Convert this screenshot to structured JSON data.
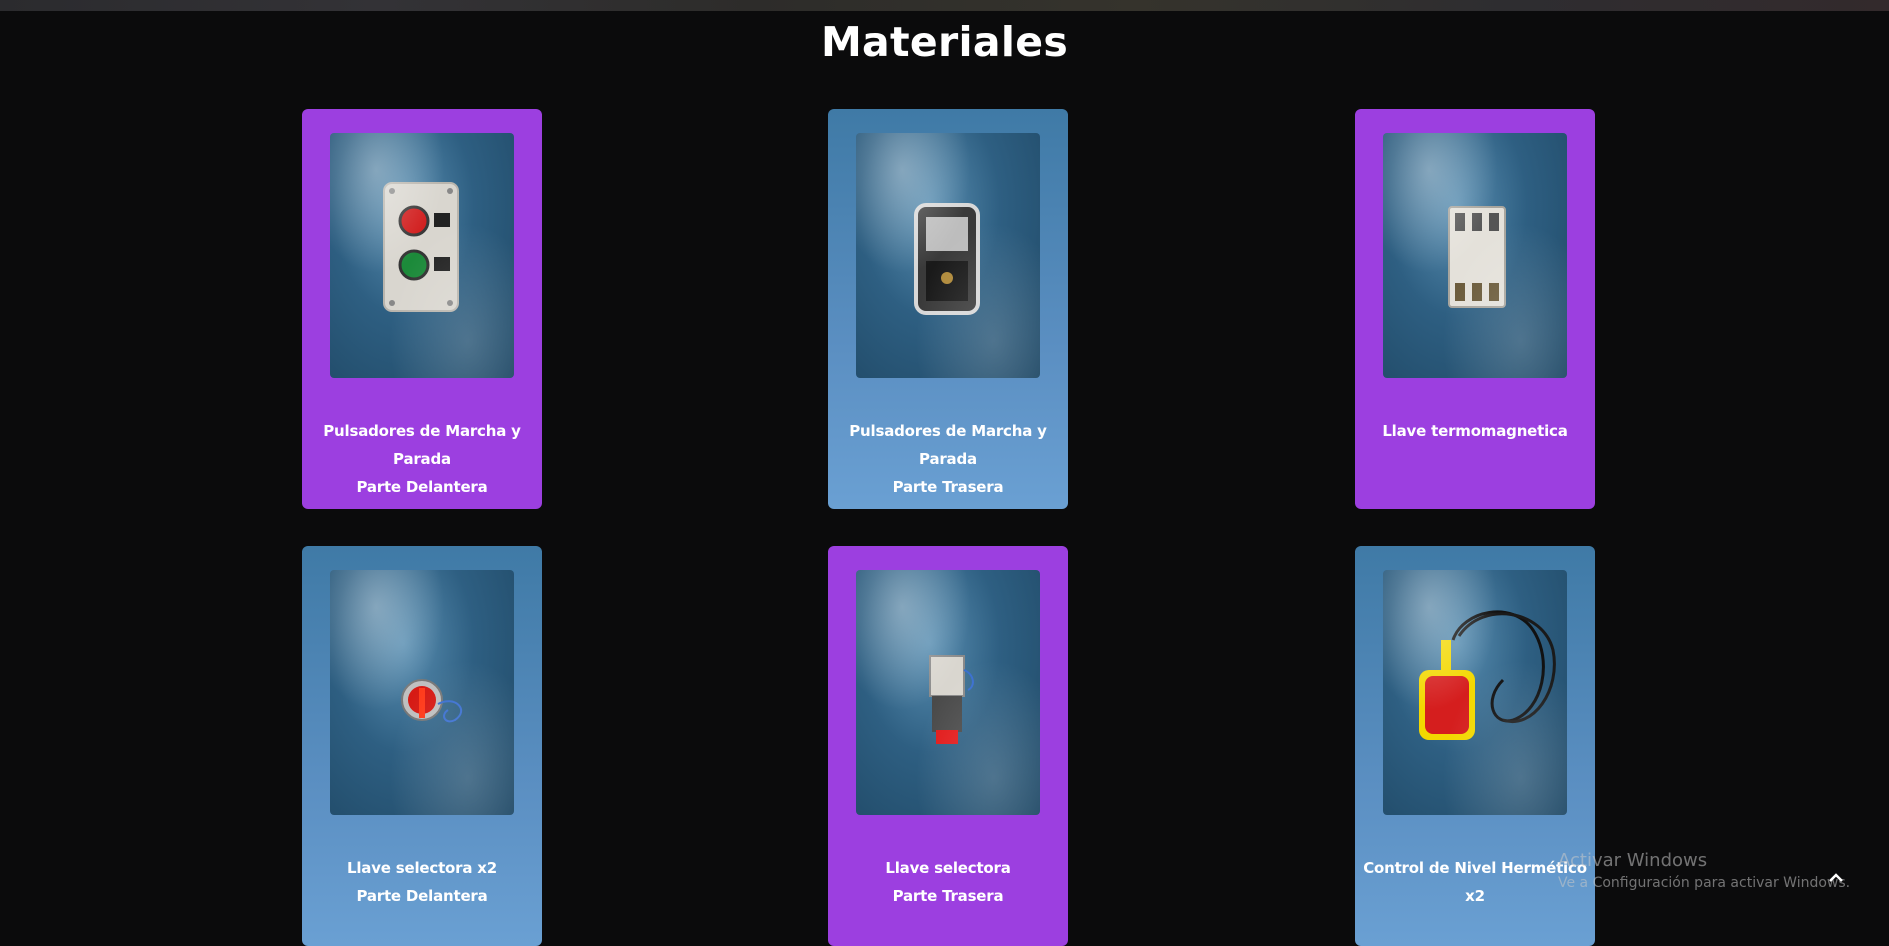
{
  "page": {
    "title": "Materiales"
  },
  "cards": [
    {
      "line1": "Pulsadores de Marcha y Parada",
      "line2": "Parte Delantera",
      "image": "pushbutton-station-front",
      "color": "#9c3fe0"
    },
    {
      "line1": "Pulsadores de Marcha y Parada",
      "line2": "Parte Trasera",
      "image": "pushbutton-station-back",
      "color": "#5b8fc2"
    },
    {
      "line1": "Llave termomagnetica",
      "line2": "",
      "image": "circuit-breaker",
      "color": "#9c3fe0"
    },
    {
      "line1": "Llave selectora x2",
      "line2": "Parte Delantera",
      "image": "selector-switch-front",
      "color": "#5b8fc2"
    },
    {
      "line1": "Llave selectora",
      "line2": "Parte Trasera",
      "image": "selector-switch-back",
      "color": "#9c3fe0"
    },
    {
      "line1": "Control de Nivel Hermético x2",
      "line2": "",
      "image": "float-level-switch",
      "color": "#5b8fc2"
    }
  ],
  "watermark": {
    "line1": "Activar Windows",
    "line2": "Ve a Configuración para activar Windows."
  },
  "scroll_top_icon": "chevron-up-icon"
}
